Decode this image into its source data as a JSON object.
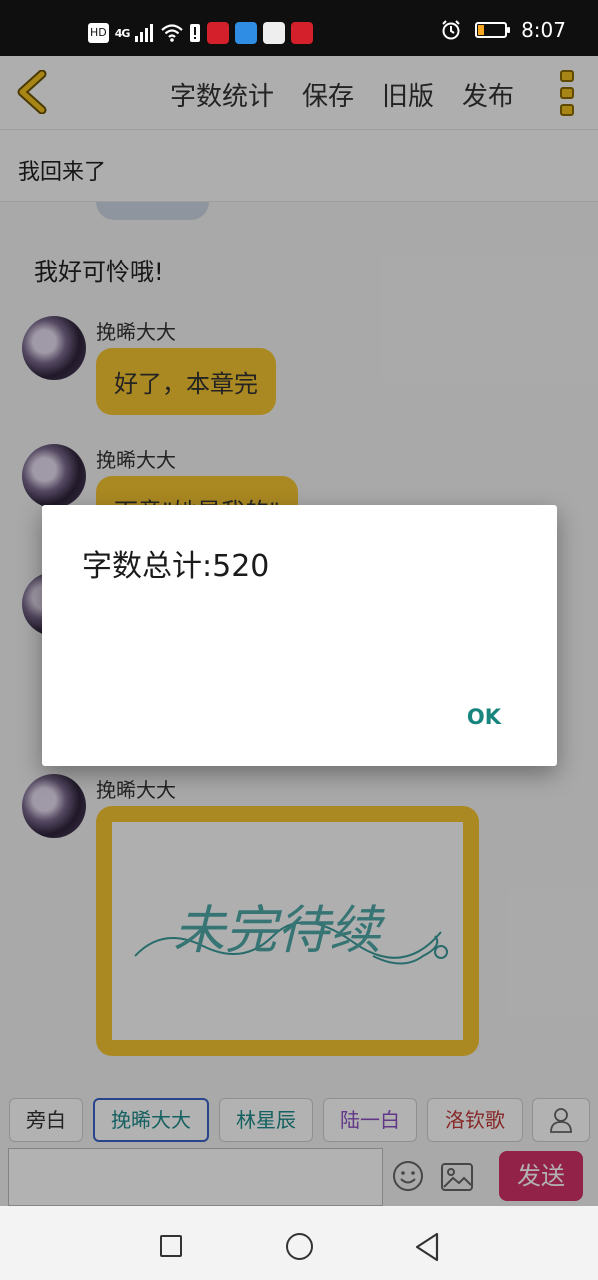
{
  "status_bar": {
    "network": "HD",
    "signal": "4G",
    "time": "8:07",
    "battery_level": 0.2
  },
  "toolbar": {
    "word_count_label": "字数统计",
    "save_label": "保存",
    "old_version_label": "旧版",
    "publish_label": "发布"
  },
  "chapter": {
    "title": "我回来了"
  },
  "chat": {
    "narration": "我好可怜哦!",
    "messages": [
      {
        "sender": "挽晞大大",
        "text": "好了，本章完"
      },
      {
        "sender": "挽晞大大",
        "text": "下章\"她是我的\""
      },
      {
        "sender": "挽晞大大",
        "image_text": "未完待续"
      }
    ]
  },
  "characters": [
    "旁白",
    "挽晞大大",
    "林星辰",
    "陆一白",
    "洛钦歌"
  ],
  "character_colors": [
    "#333333",
    "#1f8a8a",
    "#1f8a8a",
    "#8b4fc2",
    "#c23a3a"
  ],
  "input": {
    "placeholder": "",
    "send_label": "发送"
  },
  "dialog": {
    "message": "字数总计:520",
    "ok_label": "OK"
  },
  "colors": {
    "accent_yellow": "#f5c531",
    "send_pink": "#d33167",
    "ok_teal": "#17857d",
    "active_blue": "#3a64c9"
  }
}
